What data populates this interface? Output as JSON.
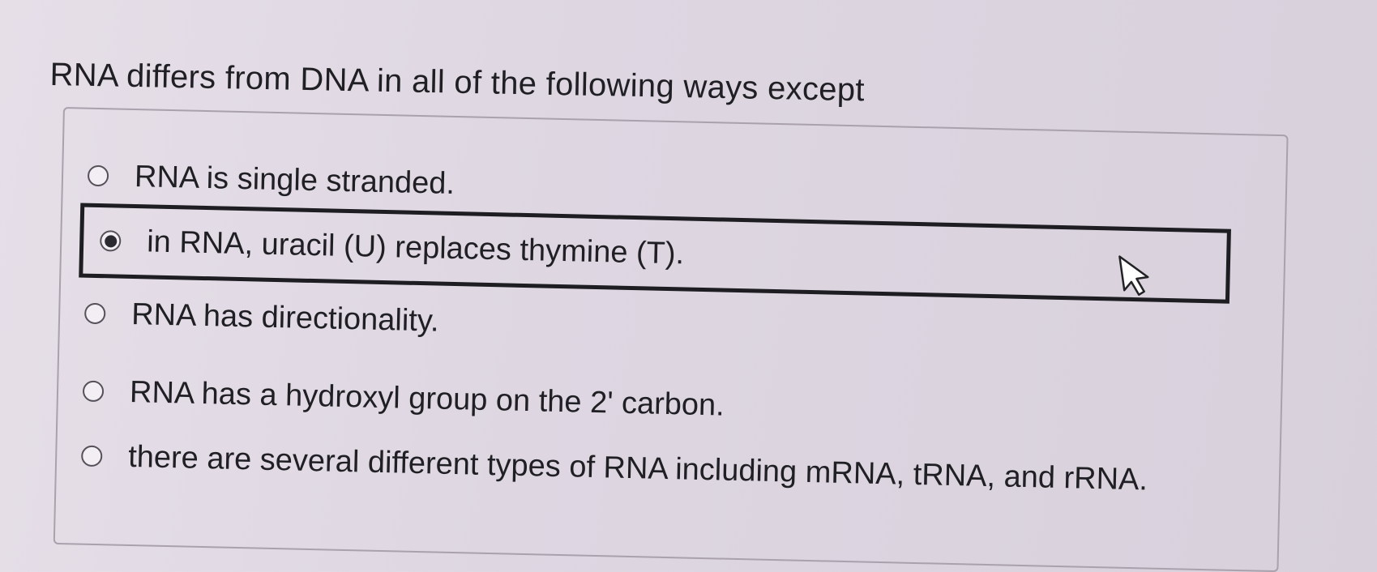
{
  "question": {
    "text": "RNA differs from DNA in all of the following ways except"
  },
  "options": [
    {
      "label": "RNA is single stranded.",
      "selected": false
    },
    {
      "label": "in RNA, uracil (U) replaces thymine (T).",
      "selected": true
    },
    {
      "label": "RNA has directionality.",
      "selected": false
    },
    {
      "label": "RNA has a hydroxyl group on the 2' carbon.",
      "selected": false
    },
    {
      "label": "there are several different types of RNA including mRNA, tRNA, and rRNA.",
      "selected": false
    }
  ],
  "colors": {
    "background": "#ded7e2",
    "text": "#1f1f24",
    "selected_border": "#1d1d22"
  },
  "icons": {
    "radio_unselected": "radio-unselected-icon",
    "radio_selected": "radio-selected-icon",
    "cursor": "mouse-pointer-icon"
  }
}
